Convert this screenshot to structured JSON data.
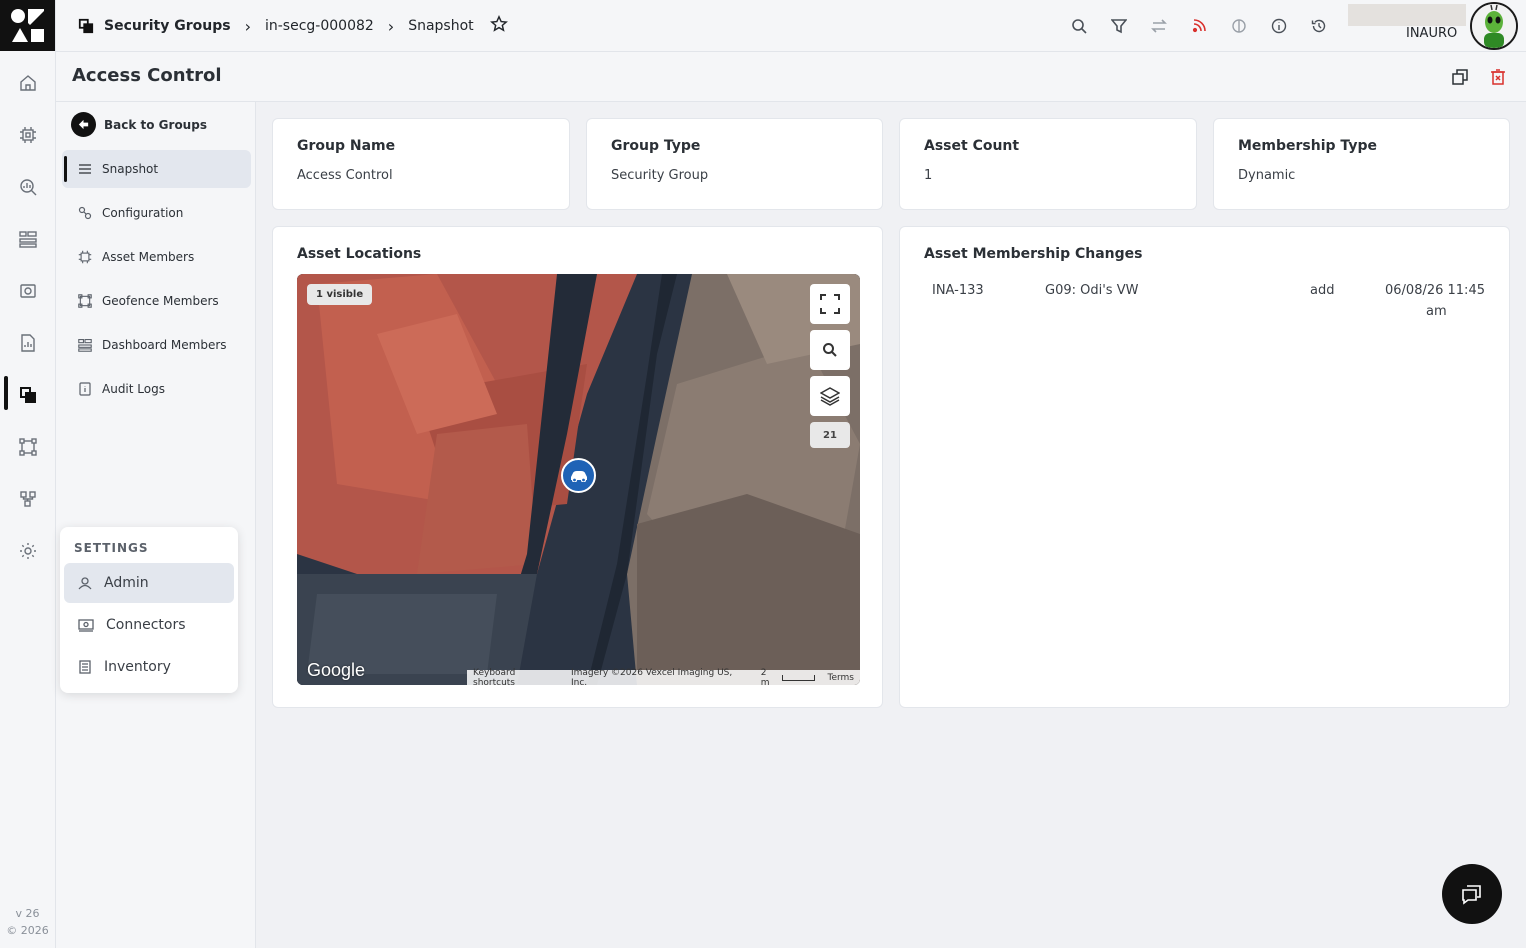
{
  "rail": {
    "icons": [
      "home-icon",
      "chip-icon",
      "analytics-icon",
      "dashboard-icon",
      "camera-icon",
      "report-icon",
      "groups-icon",
      "geofence-icon",
      "network-icon",
      "settings-icon"
    ],
    "version": "v 26",
    "copyright": "© 2026"
  },
  "breadcrumb": {
    "root": "Security Groups",
    "group": "in-secg-000082",
    "page": "Snapshot"
  },
  "user": {
    "name": "INAURO"
  },
  "header": {
    "title": "Access Control"
  },
  "subnav": {
    "back_label": "Back to Groups",
    "items": [
      {
        "label": "Snapshot"
      },
      {
        "label": "Configuration"
      },
      {
        "label": "Asset Members"
      },
      {
        "label": "Geofence Members"
      },
      {
        "label": "Dashboard Members"
      },
      {
        "label": "Audit Logs"
      }
    ]
  },
  "settings": {
    "title": "SETTINGS",
    "items": [
      {
        "label": "Admin"
      },
      {
        "label": "Connectors"
      },
      {
        "label": "Inventory"
      }
    ]
  },
  "summary": {
    "group_name": {
      "label": "Group Name",
      "value": "Access Control"
    },
    "group_type": {
      "label": "Group Type",
      "value": "Security Group"
    },
    "asset_count": {
      "label": "Asset Count",
      "value": "1"
    },
    "membership_type": {
      "label": "Membership Type",
      "value": "Dynamic"
    }
  },
  "locations": {
    "title": "Asset Locations",
    "visible_chip": "1 visible",
    "zoom": "21",
    "brand": "Google",
    "attribution": {
      "shortcuts": "Keyboard shortcuts",
      "imagery": "Imagery ©2026 Vexcel Imaging US, Inc.",
      "scale": "2 m",
      "terms": "Terms"
    }
  },
  "changes": {
    "title": "Asset Membership Changes",
    "rows": [
      {
        "id": "INA-133",
        "name": "G09: Odi's VW",
        "action": "add",
        "date": "06/08/26 11:45",
        "ampm": "am"
      }
    ]
  },
  "colors": {
    "accent": "#1f63b6",
    "active_bg": "#e3e7ee",
    "danger": "#d9302c"
  }
}
